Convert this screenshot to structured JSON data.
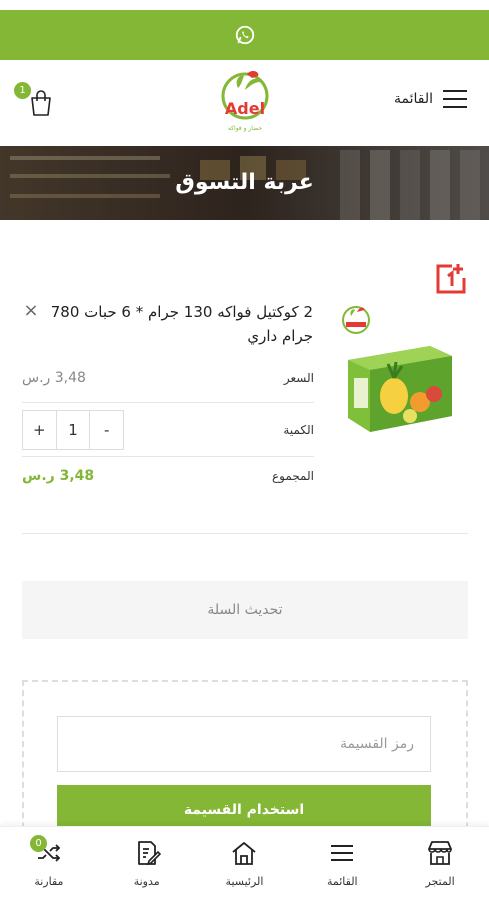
{
  "header": {
    "cart_count": "1",
    "logo_text": "Adel",
    "logo_subtitle": "خضار و فواكه",
    "menu_label": "القائمة"
  },
  "hero": {
    "title": "عربة التسوق"
  },
  "brand_mark": {
    "text": "1+"
  },
  "cart_item": {
    "name": "2 كوكتيل فواكه 130 جرام * 6 حبات 780 جرام داري",
    "remove_glyph": "×",
    "price_label": "السعر",
    "price_value": "3,48 ر.س",
    "quantity_label": "الكمية",
    "quantity_minus": "-",
    "quantity_value": "1",
    "quantity_plus": "+",
    "total_label": "المجموع",
    "total_value": "3,48 ر.س"
  },
  "update_cart_label": "تحديث السلة",
  "coupon": {
    "placeholder": "رمز القسيمة",
    "apply_label": "استخدام القسيمة"
  },
  "bottom_nav": {
    "items": [
      {
        "label": "مقارنة",
        "icon": "compare-icon",
        "badge": "0"
      },
      {
        "label": "مدونة",
        "icon": "blog-icon"
      },
      {
        "label": "الرئيسية",
        "icon": "home-icon"
      },
      {
        "label": "القائمة",
        "icon": "menu-icon"
      },
      {
        "label": "المتجر",
        "icon": "store-icon"
      }
    ]
  },
  "colors": {
    "accent": "#83b735",
    "brand_mark": "#e53935"
  }
}
